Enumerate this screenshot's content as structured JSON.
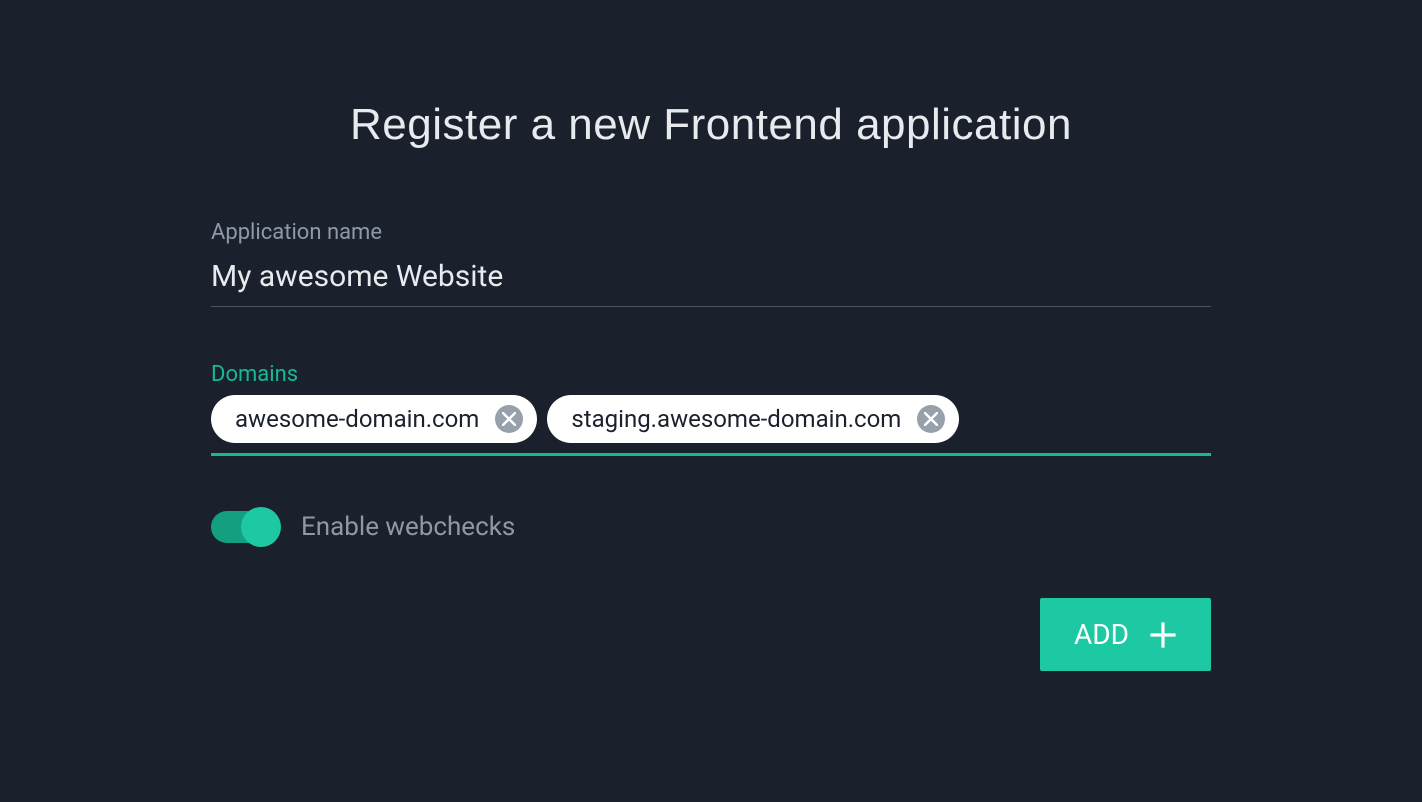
{
  "title": "Register a new Frontend application",
  "fields": {
    "appName": {
      "label": "Application name",
      "value": "My awesome Website"
    },
    "domains": {
      "label": "Domains",
      "chips": [
        "awesome-domain.com",
        "staging.awesome-domain.com"
      ]
    },
    "webchecks": {
      "label": "Enable webchecks",
      "enabled": true
    }
  },
  "actions": {
    "add": "ADD"
  }
}
